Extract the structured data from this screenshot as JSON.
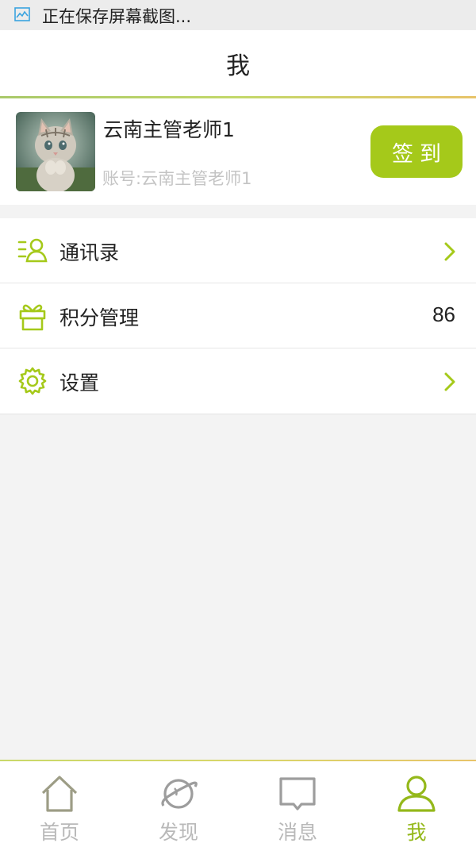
{
  "status_bar": {
    "text": "正在保存屏幕截图...",
    "icon": "screenshot-icon"
  },
  "header": {
    "title": "我"
  },
  "profile": {
    "name": "云南主管老师1",
    "account": "账号:云南主管老师1",
    "checkin_label": "签到",
    "avatar": "kitten-avatar"
  },
  "menu": {
    "contacts": {
      "label": "通讯录",
      "icon": "contacts-icon"
    },
    "points": {
      "label": "积分管理",
      "value": "86",
      "icon": "gift-icon"
    },
    "settings": {
      "label": "设置",
      "icon": "gear-icon"
    }
  },
  "tabs": [
    {
      "label": "首页",
      "icon": "home-icon",
      "active": false
    },
    {
      "label": "发现",
      "icon": "planet-icon",
      "active": false
    },
    {
      "label": "消息",
      "icon": "message-icon",
      "active": false
    },
    {
      "label": "我",
      "icon": "user-icon",
      "active": true
    }
  ],
  "colors": {
    "accent": "#a5c91a",
    "active_tab": "#94b81a",
    "inactive_tab": "#b9b9b9",
    "background": "#f3f3f3"
  }
}
